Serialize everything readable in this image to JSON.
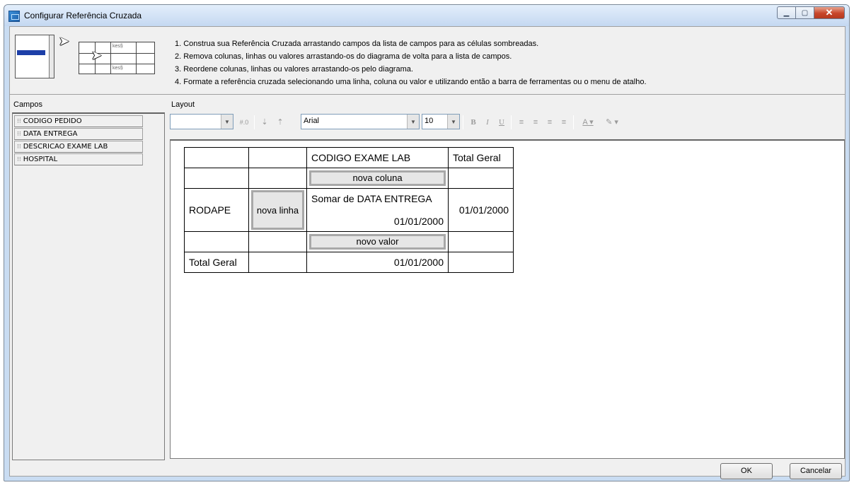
{
  "window": {
    "title": "Configurar Referência Cruzada"
  },
  "titlebar_buttons": {
    "minimize": "▁",
    "maximize": "▢",
    "close": "✕"
  },
  "illustration": {
    "grid_text_1": "kes§",
    "grid_text_2": "kes§"
  },
  "instructions": [
    "1. Construa sua Referência Cruzada arrastando campos da lista de campos para as células sombreadas.",
    "2. Remova colunas, linhas ou valores arrastando-os do diagrama de volta para a lista de campos.",
    "3. Reordene colunas, linhas ou valores arrastando-os pelo diagrama.",
    "4. Formate a referência cruzada selecionando uma linha, coluna ou valor e utilizando então a barra de ferramentas ou o menu de atalho."
  ],
  "campos": {
    "label": "Campos",
    "items": [
      "CODIGO PEDIDO",
      "DATA ENTREGA",
      "DESCRICAO EXAME LAB",
      "HOSPITAL"
    ]
  },
  "layout": {
    "label": "Layout"
  },
  "toolbar": {
    "format_value": "",
    "number_format": "#.0",
    "font": "Arial",
    "size": "10",
    "bold": "B",
    "italic": "I",
    "underline": "U"
  },
  "crosstab": {
    "col_field": "CODIGO EXAME LAB",
    "total_geral_col": "Total Geral",
    "nova_coluna": "nova coluna",
    "row_field": "RODAPE",
    "nova_linha": "nova linha",
    "value_label": "Somar de DATA ENTREGA",
    "value": "01/01/2000",
    "total_value": "01/01/2000",
    "novo_valor": "novo valor",
    "total_geral_row": "Total Geral",
    "grand_total": "01/01/2000"
  },
  "buttons": {
    "ok": "OK",
    "cancel": "Cancelar"
  }
}
